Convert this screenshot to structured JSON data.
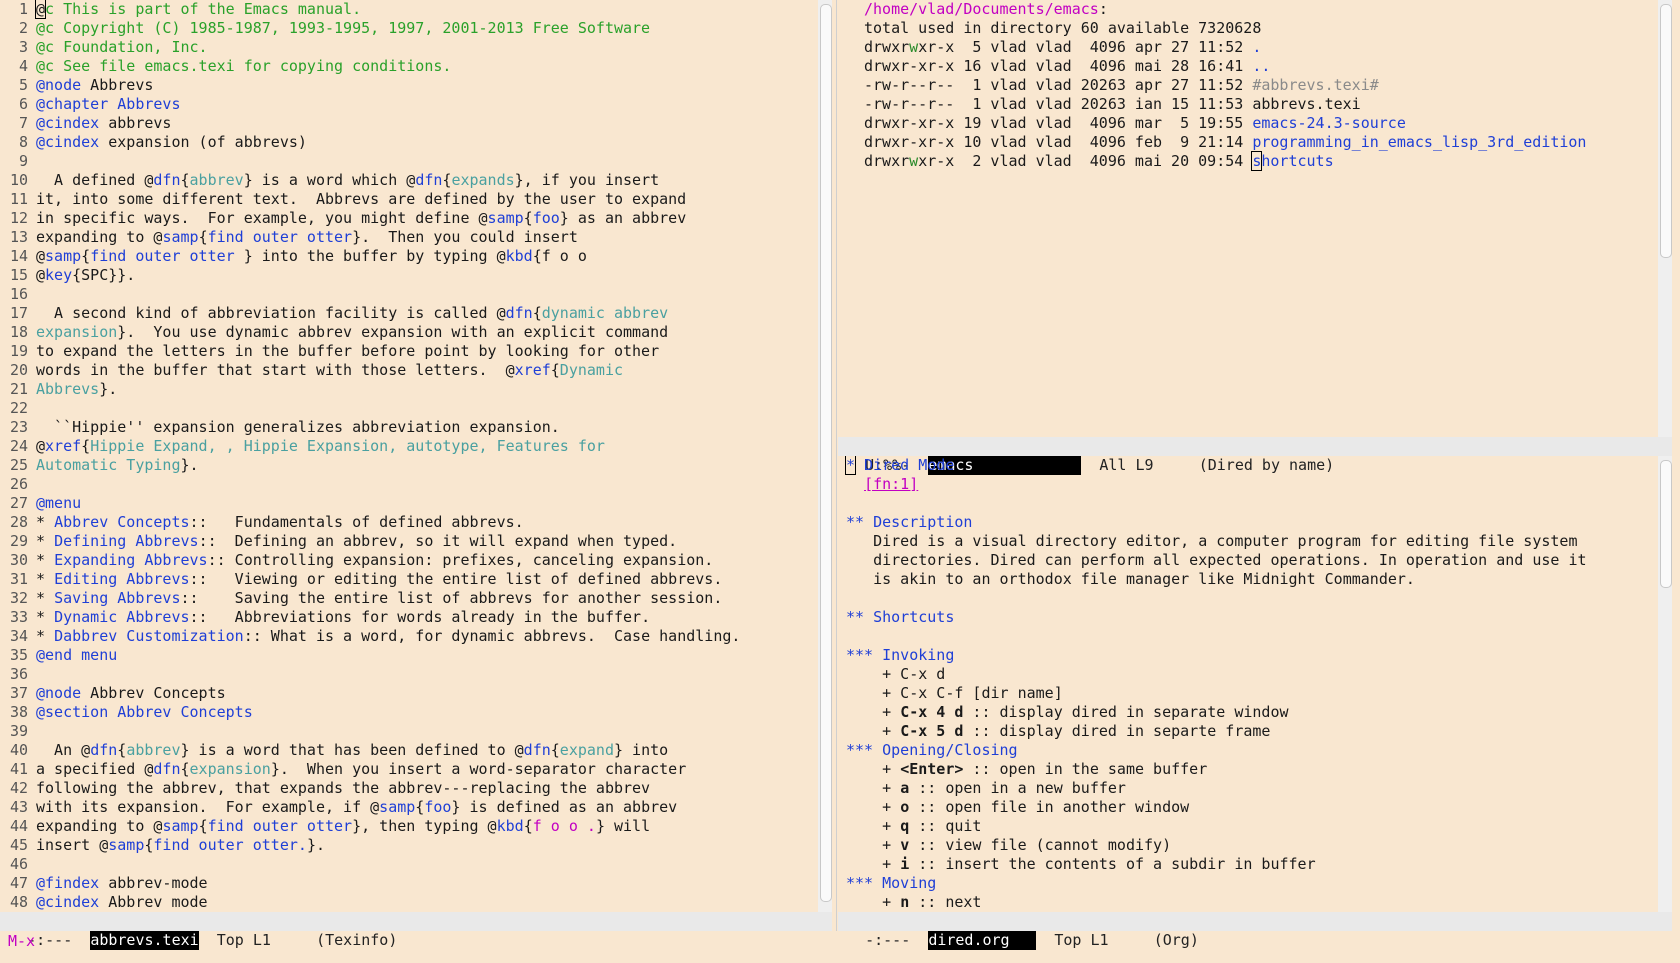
{
  "left": {
    "lines": [
      {
        "n": "1",
        "t": [
          {
            "s": "@",
            "c": "cursor"
          },
          {
            "s": "c This is part of the Emacs manual.",
            "c": "c-com"
          }
        ]
      },
      {
        "n": "2",
        "t": [
          {
            "s": "@c Copyright (C) 1985-1987, 1993-1995, 1997, 2001-2013 Free Software",
            "c": "c-com"
          }
        ]
      },
      {
        "n": "3",
        "t": [
          {
            "s": "@c Foundation, Inc.",
            "c": "c-com"
          }
        ]
      },
      {
        "n": "4",
        "t": [
          {
            "s": "@c See file emacs.texi for copying conditions.",
            "c": "c-com"
          }
        ]
      },
      {
        "n": "5",
        "t": [
          {
            "s": "@node",
            "c": "c-kw"
          },
          {
            "s": " Abbrevs"
          }
        ]
      },
      {
        "n": "6",
        "t": [
          {
            "s": "@chapter Abbrevs",
            "c": "c-kw"
          }
        ]
      },
      {
        "n": "7",
        "t": [
          {
            "s": "@cindex",
            "c": "c-kw"
          },
          {
            "s": " abbrevs"
          }
        ]
      },
      {
        "n": "8",
        "t": [
          {
            "s": "@cindex",
            "c": "c-kw"
          },
          {
            "s": " expansion (of abbrevs)"
          }
        ]
      },
      {
        "n": "9",
        "t": []
      },
      {
        "n": "10",
        "t": [
          {
            "s": "  A defined @"
          },
          {
            "s": "dfn",
            "c": "c-kw"
          },
          {
            "s": "{"
          },
          {
            "s": "abbrev",
            "c": "c-arg"
          },
          {
            "s": "} is a word which @"
          },
          {
            "s": "dfn",
            "c": "c-kw"
          },
          {
            "s": "{"
          },
          {
            "s": "expands",
            "c": "c-arg"
          },
          {
            "s": "}, if you insert"
          }
        ]
      },
      {
        "n": "11",
        "t": [
          {
            "s": "it, into some different text.  Abbrevs are defined by the user to expand"
          }
        ]
      },
      {
        "n": "12",
        "t": [
          {
            "s": "in specific ways.  For example, you might define @"
          },
          {
            "s": "samp",
            "c": "c-kw"
          },
          {
            "s": "{"
          },
          {
            "s": "foo",
            "c": "c-kw"
          },
          {
            "s": "} as an abbrev"
          }
        ]
      },
      {
        "n": "13",
        "t": [
          {
            "s": "expanding to @"
          },
          {
            "s": "samp",
            "c": "c-kw"
          },
          {
            "s": "{"
          },
          {
            "s": "find outer otter",
            "c": "c-kw"
          },
          {
            "s": "}.  Then you could insert"
          }
        ]
      },
      {
        "n": "14",
        "t": [
          {
            "s": "@"
          },
          {
            "s": "samp",
            "c": "c-kw"
          },
          {
            "s": "{"
          },
          {
            "s": "find outer otter ",
            "c": "c-kw"
          },
          {
            "s": "} into the buffer by typing @"
          },
          {
            "s": "kbd",
            "c": "c-kw"
          },
          {
            "s": "{f o o"
          }
        ]
      },
      {
        "n": "15",
        "t": [
          {
            "s": "@"
          },
          {
            "s": "key",
            "c": "c-kw"
          },
          {
            "s": "{SPC}}."
          }
        ]
      },
      {
        "n": "16",
        "t": []
      },
      {
        "n": "17",
        "t": [
          {
            "s": "  A second kind of abbreviation facility is called @"
          },
          {
            "s": "dfn",
            "c": "c-kw"
          },
          {
            "s": "{"
          },
          {
            "s": "dynamic abbrev",
            "c": "c-arg"
          }
        ]
      },
      {
        "n": "18",
        "t": [
          {
            "s": "expansion",
            "c": "c-arg"
          },
          {
            "s": "}.  You use dynamic abbrev expansion with an explicit command"
          }
        ]
      },
      {
        "n": "19",
        "t": [
          {
            "s": "to expand the letters in the buffer before point by looking for other"
          }
        ]
      },
      {
        "n": "20",
        "t": [
          {
            "s": "words in the buffer that start with those letters.  @"
          },
          {
            "s": "xref",
            "c": "c-kw"
          },
          {
            "s": "{"
          },
          {
            "s": "Dynamic",
            "c": "c-arg"
          }
        ]
      },
      {
        "n": "21",
        "t": [
          {
            "s": "Abbrevs",
            "c": "c-arg"
          },
          {
            "s": "}."
          }
        ]
      },
      {
        "n": "22",
        "t": []
      },
      {
        "n": "23",
        "t": [
          {
            "s": "  ``Hippie'' expansion generalizes abbreviation expansion."
          }
        ]
      },
      {
        "n": "24",
        "t": [
          {
            "s": "@"
          },
          {
            "s": "xref",
            "c": "c-kw"
          },
          {
            "s": "{"
          },
          {
            "s": "Hippie Expand, , Hippie Expansion, autotype, Features for",
            "c": "c-arg"
          }
        ]
      },
      {
        "n": "25",
        "t": [
          {
            "s": "Automatic Typing",
            "c": "c-arg"
          },
          {
            "s": "}."
          }
        ]
      },
      {
        "n": "26",
        "t": []
      },
      {
        "n": "27",
        "t": [
          {
            "s": "@menu",
            "c": "c-kw"
          }
        ]
      },
      {
        "n": "28",
        "t": [
          {
            "s": "* "
          },
          {
            "s": "Abbrev Concepts",
            "c": "c-kw"
          },
          {
            "s": "::   Fundamentals of defined abbrevs."
          }
        ]
      },
      {
        "n": "29",
        "t": [
          {
            "s": "* "
          },
          {
            "s": "Defining Abbrevs",
            "c": "c-kw"
          },
          {
            "s": "::  Defining an abbrev, so it will expand when typed."
          }
        ]
      },
      {
        "n": "30",
        "t": [
          {
            "s": "* "
          },
          {
            "s": "Expanding Abbrevs",
            "c": "c-kw"
          },
          {
            "s": ":: Controlling expansion: prefixes, canceling expansion."
          }
        ]
      },
      {
        "n": "31",
        "t": [
          {
            "s": "* "
          },
          {
            "s": "Editing Abbrevs",
            "c": "c-kw"
          },
          {
            "s": "::   Viewing or editing the entire list of defined abbrevs."
          }
        ]
      },
      {
        "n": "32",
        "t": [
          {
            "s": "* "
          },
          {
            "s": "Saving Abbrevs",
            "c": "c-kw"
          },
          {
            "s": "::    Saving the entire list of abbrevs for another session."
          }
        ]
      },
      {
        "n": "33",
        "t": [
          {
            "s": "* "
          },
          {
            "s": "Dynamic Abbrevs",
            "c": "c-kw"
          },
          {
            "s": "::   Abbreviations for words already in the buffer."
          }
        ]
      },
      {
        "n": "34",
        "t": [
          {
            "s": "* "
          },
          {
            "s": "Dabbrev Customization",
            "c": "c-kw"
          },
          {
            "s": ":: What is a word, for dynamic abbrevs.  Case handling."
          }
        ]
      },
      {
        "n": "35",
        "t": [
          {
            "s": "@end menu",
            "c": "c-kw"
          }
        ]
      },
      {
        "n": "36",
        "t": []
      },
      {
        "n": "37",
        "t": [
          {
            "s": "@node",
            "c": "c-kw"
          },
          {
            "s": " Abbrev Concepts"
          }
        ]
      },
      {
        "n": "38",
        "t": [
          {
            "s": "@section Abbrev Concepts",
            "c": "c-kw"
          }
        ]
      },
      {
        "n": "39",
        "t": []
      },
      {
        "n": "40",
        "t": [
          {
            "s": "  An @"
          },
          {
            "s": "dfn",
            "c": "c-kw"
          },
          {
            "s": "{"
          },
          {
            "s": "abbrev",
            "c": "c-arg"
          },
          {
            "s": "} is a word that has been defined to @"
          },
          {
            "s": "dfn",
            "c": "c-kw"
          },
          {
            "s": "{"
          },
          {
            "s": "expand",
            "c": "c-arg"
          },
          {
            "s": "} into"
          }
        ]
      },
      {
        "n": "41",
        "t": [
          {
            "s": "a specified @"
          },
          {
            "s": "dfn",
            "c": "c-kw"
          },
          {
            "s": "{"
          },
          {
            "s": "expansion",
            "c": "c-arg"
          },
          {
            "s": "}.  When you insert a word-separator character"
          }
        ]
      },
      {
        "n": "42",
        "t": [
          {
            "s": "following the abbrev, that expands the abbrev---replacing the abbrev"
          }
        ]
      },
      {
        "n": "43",
        "t": [
          {
            "s": "with its expansion.  For example, if @"
          },
          {
            "s": "samp",
            "c": "c-kw"
          },
          {
            "s": "{"
          },
          {
            "s": "foo",
            "c": "c-kw"
          },
          {
            "s": "} is defined as an abbrev"
          }
        ]
      },
      {
        "n": "44",
        "t": [
          {
            "s": "expanding to @"
          },
          {
            "s": "samp",
            "c": "c-kw"
          },
          {
            "s": "{"
          },
          {
            "s": "find outer otter",
            "c": "c-kw"
          },
          {
            "s": "}, then typing @"
          },
          {
            "s": "kbd",
            "c": "c-kw"
          },
          {
            "s": "{"
          },
          {
            "s": "f o o .",
            "c": "c-mag"
          },
          {
            "s": "} will"
          }
        ]
      },
      {
        "n": "45",
        "t": [
          {
            "s": "insert @"
          },
          {
            "s": "samp",
            "c": "c-kw"
          },
          {
            "s": "{"
          },
          {
            "s": "find outer otter.",
            "c": "c-kw"
          },
          {
            "s": "}."
          }
        ]
      },
      {
        "n": "46",
        "t": []
      },
      {
        "n": "47",
        "t": [
          {
            "s": "@findex",
            "c": "c-kw"
          },
          {
            "s": " abbrev-mode"
          }
        ]
      },
      {
        "n": "48",
        "t": [
          {
            "s": "@cindex",
            "c": "c-kw"
          },
          {
            "s": " Abbrev mode"
          }
        ]
      }
    ],
    "modeline": {
      "status": " -:---  ",
      "buffer": "abbrevs.texi",
      "position": "  Top L1     ",
      "mode": "(Texinfo)"
    }
  },
  "dired": {
    "lines": [
      [
        {
          "s": "/home/vlad/Documents/emacs",
          "c": "c-mag"
        },
        {
          "s": ":"
        }
      ],
      [
        {
          "s": "total used in directory 60 available 7320628"
        }
      ],
      [
        {
          "s": "drwxr"
        },
        {
          "s": "w",
          "c": "c-green-w"
        },
        {
          "s": "xr-x  5 vlad vlad  4096 apr 27 11:52 "
        },
        {
          "s": ".",
          "c": "c-kw"
        }
      ],
      [
        {
          "s": "drwxr-xr-x 16 vlad vlad  4096 mai 28 16:41 "
        },
        {
          "s": "..",
          "c": "c-kw"
        }
      ],
      [
        {
          "s": "-rw-r--r--  1 vlad vlad 20263 apr 27 11:52 "
        },
        {
          "s": "#abbrevs.texi#",
          "c": "c-gray"
        }
      ],
      [
        {
          "s": "-rw-r--r--  1 vlad vlad 20263 ian 15 11:53 abbrevs.texi"
        }
      ],
      [
        {
          "s": "drwxr-xr-x 19 vlad vlad  4096 mar  5 19:55 "
        },
        {
          "s": "emacs-24.3-source",
          "c": "c-kw"
        }
      ],
      [
        {
          "s": "drwxr-xr-x 10 vlad vlad  4096 feb  9 21:14 "
        },
        {
          "s": "programming_in_emacs_lisp_3rd_edition",
          "c": "c-kw"
        }
      ],
      [
        {
          "s": "drwxr"
        },
        {
          "s": "w",
          "c": "c-green-w"
        },
        {
          "s": "xr-x  2 vlad vlad  4096 mai 20 09:54 "
        },
        {
          "s": "s",
          "c": "cursor c-kw"
        },
        {
          "s": "hortcuts",
          "c": "c-kw"
        }
      ]
    ],
    "modeline": {
      "status": " U:%%-  ",
      "buffer": "emacs",
      "position": "  All L9     ",
      "mode": "(Dired by name)"
    }
  },
  "org": {
    "lines": [
      [
        {
          "s": "*",
          "c": "cursor c-kw"
        },
        {
          "s": " Dired Mode",
          "c": "c-kw"
        }
      ],
      [
        {
          "s": "  "
        },
        {
          "s": "[fn:1]",
          "c": "c-mag-u"
        }
      ],
      [],
      [
        {
          "s": "** Description",
          "c": "c-kw"
        }
      ],
      [
        {
          "s": "   Dired is a visual directory editor, a computer program for editing file system"
        }
      ],
      [
        {
          "s": "   directories. Dired can perform all expected operations. In operation and use it"
        }
      ],
      [
        {
          "s": "   is akin to an orthodox file manager like Midnight Commander."
        }
      ],
      [],
      [
        {
          "s": "** Shortcuts",
          "c": "c-kw"
        }
      ],
      [],
      [
        {
          "s": "*** Invoking",
          "c": "c-kw"
        }
      ],
      [
        {
          "s": "    + C-x d"
        }
      ],
      [
        {
          "s": "    + C-x C-f [dir name]"
        }
      ],
      [
        {
          "s": "    + "
        },
        {
          "s": "C-x 4 d",
          "c": "b"
        },
        {
          "s": " :: display dired in separate window"
        }
      ],
      [
        {
          "s": "    + "
        },
        {
          "s": "C-x 5 d",
          "c": "b"
        },
        {
          "s": " :: display dired in separte frame"
        }
      ],
      [
        {
          "s": "*** Opening/Closing",
          "c": "c-kw"
        }
      ],
      [
        {
          "s": "    + "
        },
        {
          "s": "<Enter>",
          "c": "b"
        },
        {
          "s": " :: open in the same buffer"
        }
      ],
      [
        {
          "s": "    + "
        },
        {
          "s": "a",
          "c": "b"
        },
        {
          "s": " :: open in a new buffer"
        }
      ],
      [
        {
          "s": "    + "
        },
        {
          "s": "o",
          "c": "b"
        },
        {
          "s": " :: open file in another window"
        }
      ],
      [
        {
          "s": "    + "
        },
        {
          "s": "q",
          "c": "b"
        },
        {
          "s": " :: quit"
        }
      ],
      [
        {
          "s": "    + "
        },
        {
          "s": "v",
          "c": "b"
        },
        {
          "s": " :: view file (cannot modify)"
        }
      ],
      [
        {
          "s": "    + "
        },
        {
          "s": "i",
          "c": "b"
        },
        {
          "s": " :: insert the contents of a subdir in buffer"
        }
      ],
      [
        {
          "s": "*** Moving",
          "c": "c-kw"
        }
      ],
      [
        {
          "s": "    + "
        },
        {
          "s": "n",
          "c": "b"
        },
        {
          "s": " :: next"
        }
      ]
    ],
    "modeline": {
      "status": " -:---  ",
      "buffer": "dired.org",
      "position": "  Top L1     ",
      "mode": "(Org)"
    }
  },
  "minibuffer": {
    "text": "M-x"
  }
}
